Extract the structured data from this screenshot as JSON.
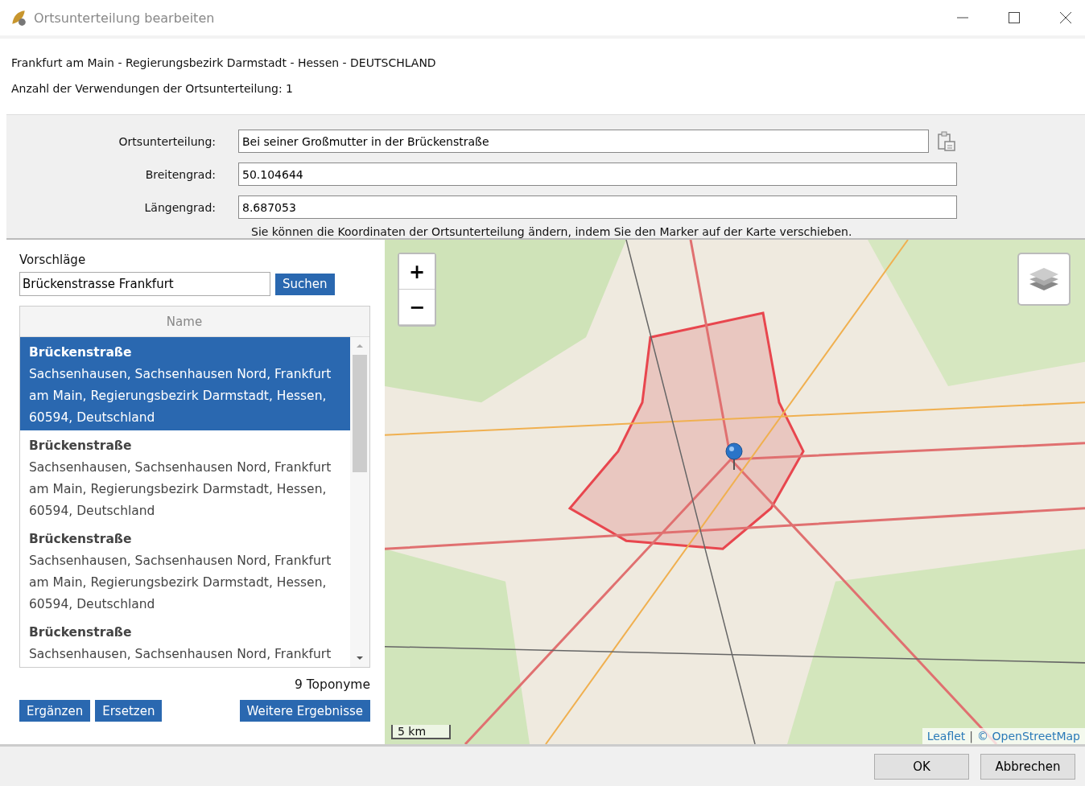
{
  "window": {
    "title": "Ortsunterteilung bearbeiten"
  },
  "info": {
    "location": "Frankfurt am Main - Regierungsbezirk Darmstadt - Hessen - DEUTSCHLAND",
    "usage": "Anzahl der Verwendungen der Ortsunterteilung: 1"
  },
  "form": {
    "fields": [
      {
        "label": "Ortsunterteilung:",
        "value": "Bei seiner Großmutter in der Brückenstraße",
        "paste": true
      },
      {
        "label": "Breitengrad:",
        "value": "50.104644",
        "paste": false
      },
      {
        "label": "Längengrad:",
        "value": "8.687053",
        "paste": false
      }
    ],
    "hint": "Sie können die Koordinaten der Ortsunterteilung ändern, indem Sie den Marker auf der Karte verschieben."
  },
  "suggestions": {
    "label": "Vorschläge",
    "query": "Brückenstrasse Frankfurt",
    "search_button": "Suchen",
    "column": "Name",
    "results": [
      {
        "name": "Brückenstraße",
        "address": "Sachsenhausen, Sachsenhausen Nord, Frankfurt am Main, Regierungsbezirk Darmstadt, Hessen, 60594, Deutschland",
        "selected": true
      },
      {
        "name": "Brückenstraße",
        "address": "Sachsenhausen, Sachsenhausen Nord, Frankfurt am Main, Regierungsbezirk Darmstadt, Hessen, 60594, Deutschland",
        "selected": false
      },
      {
        "name": "Brückenstraße",
        "address": "Sachsenhausen, Sachsenhausen Nord, Frankfurt am Main, Regierungsbezirk Darmstadt, Hessen, 60594, Deutschland",
        "selected": false
      },
      {
        "name": "Brückenstraße",
        "address": "Sachsenhausen, Sachsenhausen Nord, Frankfurt",
        "selected": false
      }
    ],
    "count": "9 Toponyme",
    "buttons": [
      "Ergänzen",
      "Ersetzen"
    ],
    "more_button": "Weitere Ergebnisse"
  },
  "map": {
    "zoom_in": "+",
    "zoom_out": "−",
    "scale": "5 km",
    "attribution": [
      {
        "text": "Leaflet",
        "link": true
      },
      {
        "text": "|",
        "link": false
      },
      {
        "text": "© OpenStreetMap",
        "link": true
      }
    ]
  },
  "buttons": [
    "OK",
    "Abbrechen"
  ]
}
